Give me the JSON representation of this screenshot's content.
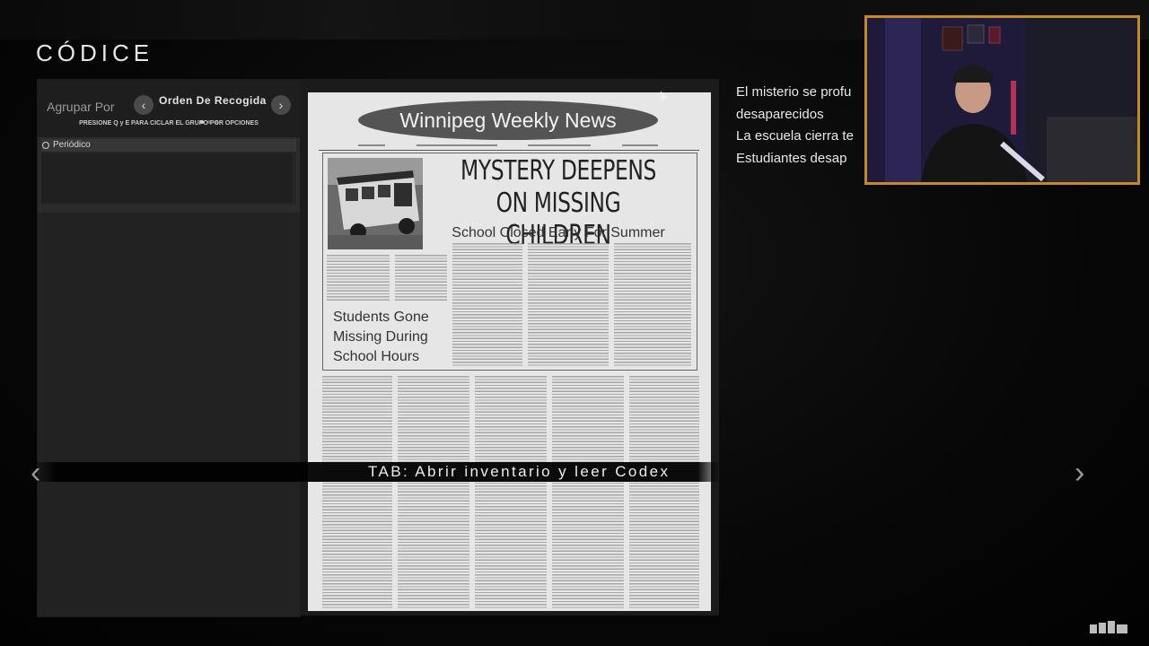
{
  "screen": {
    "title": "CÓDICE"
  },
  "group_bar": {
    "label": "Agrupar Por",
    "order_label": "Orden De Recogida",
    "hint": "PRESIONE Q y E PARA CICLAR EL GRUPO POR OPCIONES",
    "left_arrow": "‹",
    "right_arrow": "›"
  },
  "list": {
    "items": [
      {
        "label": "Periódico",
        "selected": true
      }
    ]
  },
  "newspaper": {
    "masthead": "Winnipeg Weekly News",
    "headline_line1": "MYSTERY DEEPENS",
    "headline_line2": "ON MISSING CHILDREN",
    "subhead": "School Closed Early For Summer",
    "side_line1": "Students Gone",
    "side_line2": "Missing During",
    "side_line3": "School Hours"
  },
  "prompt": {
    "text": "TAB: Abrir inventario y leer Codex"
  },
  "navigation": {
    "prev": "‹",
    "next": "›"
  },
  "description": {
    "lines": [
      "El misterio se profu",
      "desaparecidos",
      "La escuela cierra te",
      "Estudiantes desap"
    ]
  },
  "colors": {
    "webcam_border": "#c48a2a",
    "panel_bg": "#2b2b2b",
    "paper": "#e6e6e6"
  }
}
